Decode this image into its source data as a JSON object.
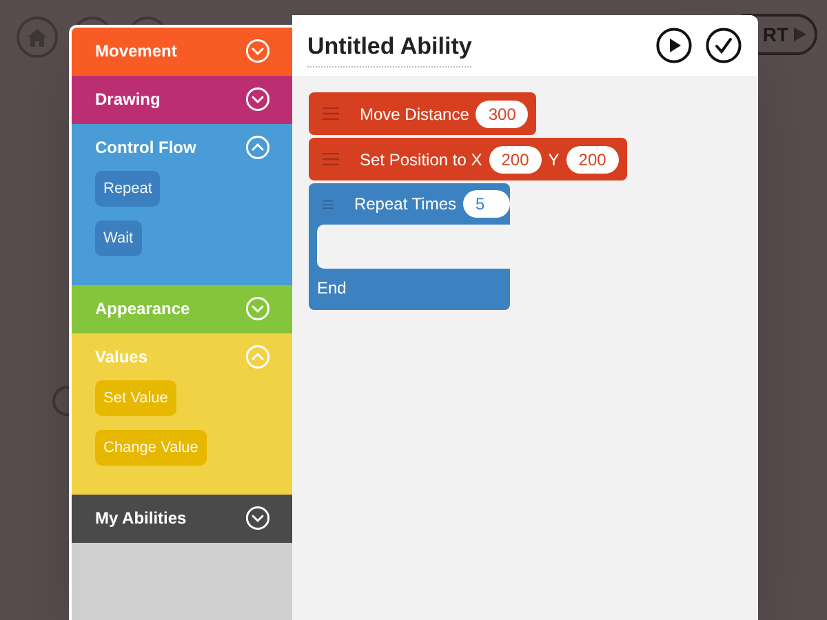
{
  "background": {
    "start_button_text": "RT"
  },
  "editor": {
    "title": "Untitled Ability"
  },
  "categories": [
    {
      "name": "Movement",
      "color": "#f95b24",
      "expanded": false
    },
    {
      "name": "Drawing",
      "color": "#bb2f72",
      "expanded": false
    },
    {
      "name": "Control Flow",
      "color": "#4a9cd6",
      "expanded": true,
      "items": [
        "Repeat",
        "Wait"
      ]
    },
    {
      "name": "Appearance",
      "color": "#84c53c",
      "expanded": false
    },
    {
      "name": "Values",
      "color": "#f2d245",
      "expanded": true,
      "items": [
        "Set Value",
        "Change Value"
      ]
    },
    {
      "name": "My Abilities",
      "color": "#4a4a4a",
      "expanded": false
    }
  ],
  "blocks": [
    {
      "kind": "command",
      "parts": [
        {
          "kind": "text",
          "text": "Move Distance"
        },
        {
          "kind": "input",
          "value": "300"
        }
      ]
    },
    {
      "kind": "command",
      "parts": [
        {
          "kind": "text",
          "text": "Set Position to X"
        },
        {
          "kind": "input",
          "value": "200"
        },
        {
          "kind": "text",
          "text": "Y"
        },
        {
          "kind": "input",
          "value": "200"
        }
      ]
    },
    {
      "kind": "loop",
      "parts": [
        {
          "kind": "text",
          "text": "Repeat Times"
        },
        {
          "kind": "input",
          "value": "5"
        }
      ],
      "end_label": "End"
    }
  ]
}
